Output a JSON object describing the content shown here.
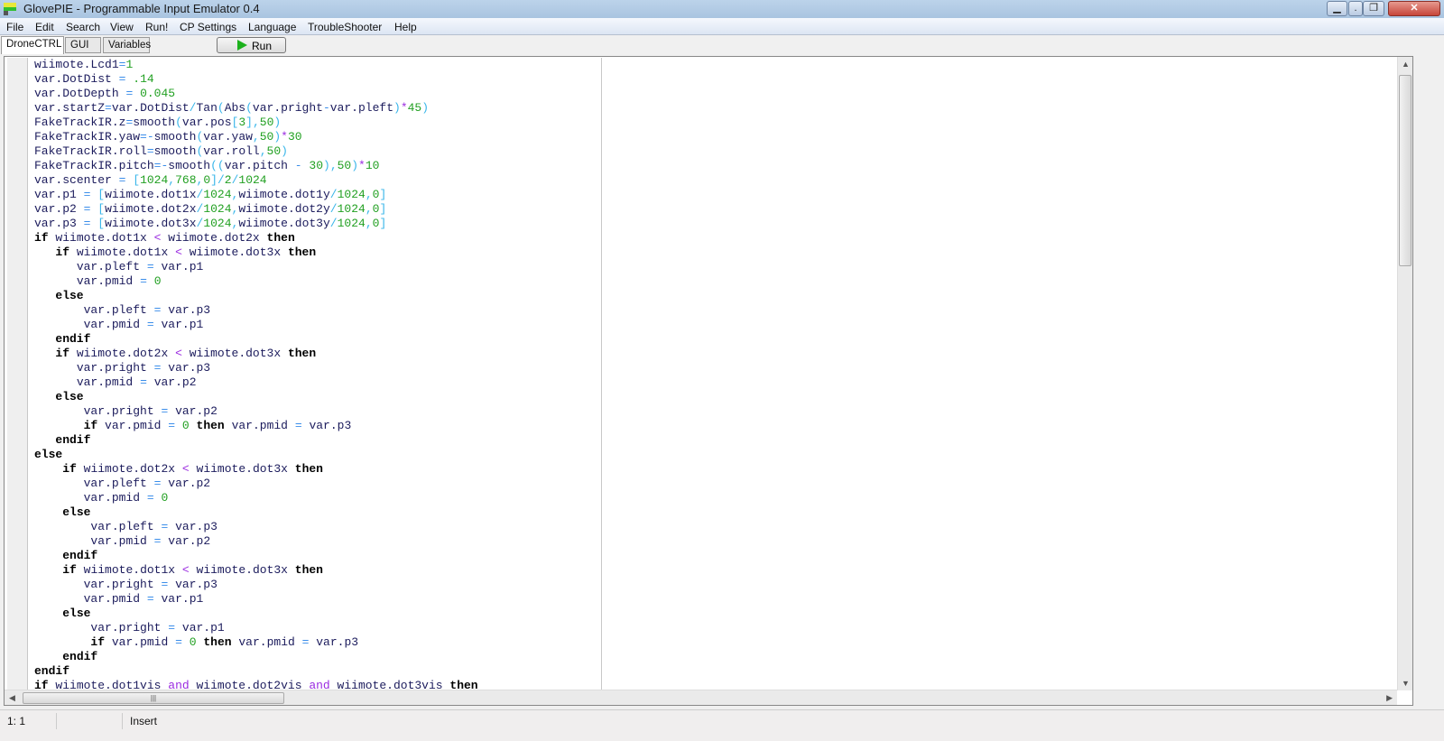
{
  "window": {
    "title": "GlovePIE - Programmable Input Emulator 0.4",
    "minimize_icon": "minimize-icon",
    "maximize_icon": "maximize-icon",
    "restore_icon": "restore-icon",
    "close_icon": "close-icon",
    "close_color": "#c7453a"
  },
  "menu": [
    "File",
    "Edit",
    "Search",
    "View",
    "Run!",
    "CP Settings",
    "Language",
    "TroubleShooter",
    "Help"
  ],
  "tabs": [
    {
      "label": "DroneCTRL",
      "active": true
    },
    {
      "label": "GUI"
    },
    {
      "label": "Variables"
    }
  ],
  "run_button": {
    "label": "Run",
    "icon": "play-icon",
    "color": "#1cb11c"
  },
  "code_lines": [
    "wiimote.Lcd1=1",
    "var.DotDist = .14",
    "var.DotDepth = 0.045",
    "var.startZ=var.DotDist/Tan(Abs(var.pright-var.pleft)*45)",
    "FakeTrackIR.z=smooth(var.pos[3],50)",
    "FakeTrackIR.yaw=-smooth(var.yaw,50)*30",
    "FakeTrackIR.roll=smooth(var.roll,50)",
    "FakeTrackIR.pitch=-smooth((var.pitch - 30),50)*10",
    "var.scenter = [1024,768,0]/2/1024",
    "var.p1 = [wiimote.dot1x/1024,wiimote.dot1y/1024,0]",
    "var.p2 = [wiimote.dot2x/1024,wiimote.dot2y/1024,0]",
    "var.p3 = [wiimote.dot3x/1024,wiimote.dot3y/1024,0]",
    "if wiimote.dot1x < wiimote.dot2x then",
    "   if wiimote.dot1x < wiimote.dot3x then",
    "      var.pleft = var.p1",
    "      var.pmid = 0",
    "   else",
    "       var.pleft = var.p3",
    "       var.pmid = var.p1",
    "   endif",
    "   if wiimote.dot2x < wiimote.dot3x then",
    "      var.pright = var.p3",
    "      var.pmid = var.p2",
    "   else",
    "       var.pright = var.p2",
    "       if var.pmid = 0 then var.pmid = var.p3",
    "   endif",
    "else",
    "    if wiimote.dot2x < wiimote.dot3x then",
    "       var.pleft = var.p2",
    "       var.pmid = 0",
    "    else",
    "        var.pleft = var.p3",
    "        var.pmid = var.p2",
    "    endif",
    "    if wiimote.dot1x < wiimote.dot3x then",
    "       var.pright = var.p3",
    "       var.pmid = var.p1",
    "    else",
    "        var.pright = var.p1",
    "        if var.pmid = 0 then var.pmid = var.p3",
    "    endif",
    "endif",
    "if wiimote.dot1vis and wiimote.dot2vis and wiimote.dot3vis then"
  ],
  "status": {
    "position": "1: 1",
    "mode": "Insert"
  }
}
